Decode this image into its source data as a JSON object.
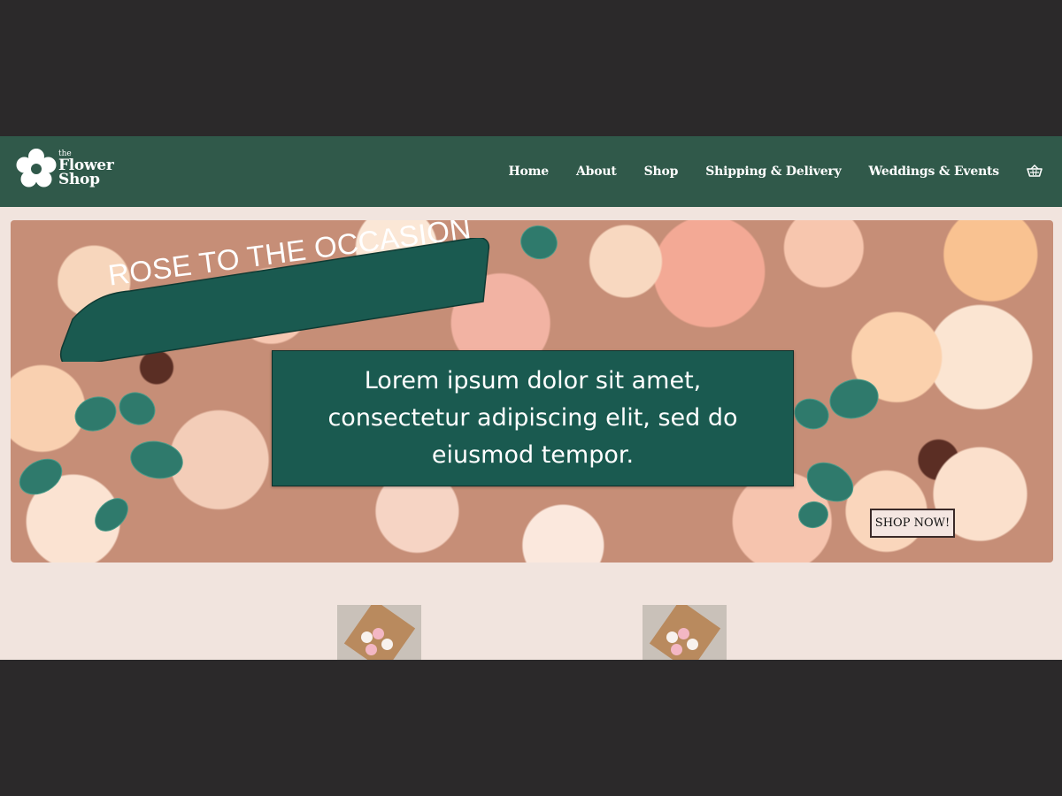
{
  "brand": {
    "logo_the": "the",
    "logo_line1": "Flower",
    "logo_line2": "Shop"
  },
  "nav": {
    "items": [
      {
        "label": "Home"
      },
      {
        "label": "About"
      },
      {
        "label": "Shop"
      },
      {
        "label": "Shipping & Delivery"
      },
      {
        "label": "Weddings & Events"
      }
    ],
    "cart_icon": "basket-icon"
  },
  "hero": {
    "headline": "ROSE TO THE OCCASION",
    "body": "Lorem ipsum dolor sit amet, consectetur adipiscing elit, sed do eiusmod tempor.",
    "cta_label": "SHOP NOW!"
  },
  "products": {
    "items": [
      {
        "image": "bouquet-image"
      },
      {
        "image": "bouquet-image"
      }
    ]
  },
  "colors": {
    "nav_bg": "#30594a",
    "page_bg": "#f1e4de",
    "banner_green": "#1a5a50",
    "outer_bg": "#2b292a"
  }
}
